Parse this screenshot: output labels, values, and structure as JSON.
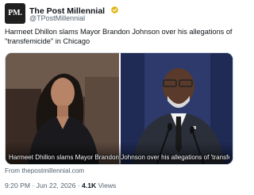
{
  "account": {
    "avatar_text": "PM.",
    "display_name": "The Post Millennial",
    "handle": "@TPostMillennial",
    "verified_color": "#e2b719"
  },
  "tweet": {
    "text": "Harmeet Dhillon slams Mayor Brandon Johnson over his allegations of \"transfemicide\" in Chicago"
  },
  "media": {
    "caption": "Harmeet Dhillon slams Mayor Brandon Johnson over his allegations of 'transfemicide' ..."
  },
  "source": {
    "text": "From thepostmillennial.com"
  },
  "meta": {
    "time": "9:20 PM",
    "separator": "·",
    "date": "Jun 22, 2026",
    "views_count": "4.1K",
    "views_label": "Views"
  }
}
